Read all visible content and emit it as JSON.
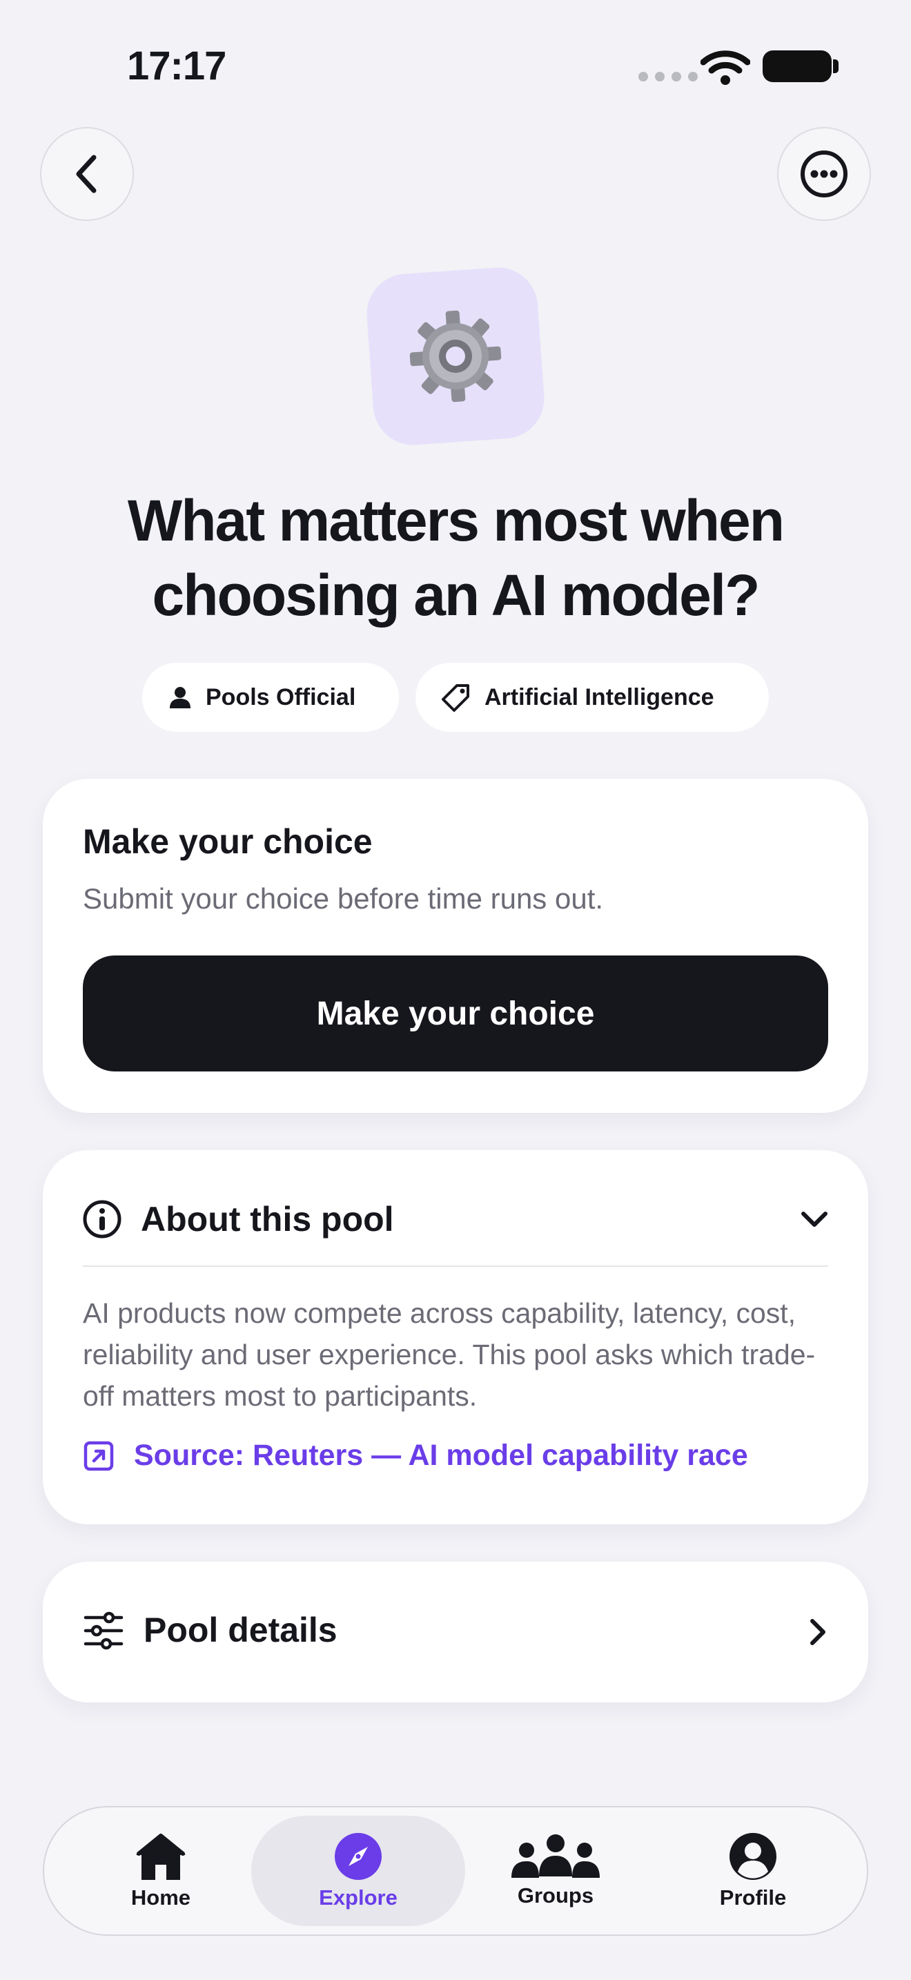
{
  "status_bar": {
    "time": "17:17"
  },
  "nav": {
    "back_icon": "chevron-left-icon",
    "more_icon": "ellipsis-circle-icon"
  },
  "pool": {
    "icon": "gear-icon",
    "title": "What matters most when choosing an AI model?",
    "owner": "Pools Official",
    "topic": "Artificial Intelligence"
  },
  "choice_card": {
    "heading": "Make your choice",
    "subtitle": "Submit your choice before time runs out.",
    "button_label": "Make your choice"
  },
  "about_card": {
    "heading": "About this pool",
    "expanded": true,
    "body": "AI products now compete across capability, latency, cost, reliability and user experience. This pool asks which trade-off matters most to participants.",
    "source_link": "Source: Reuters — AI model capability race"
  },
  "details_card": {
    "heading": "Pool details"
  },
  "tabbar": {
    "active": "Explore",
    "accent": "#6a3de8",
    "tabs": [
      {
        "label": "Home",
        "icon": "house-icon"
      },
      {
        "label": "Explore",
        "icon": "compass-icon"
      },
      {
        "label": "Groups",
        "icon": "people-icon"
      },
      {
        "label": "Profile",
        "icon": "person-circle-icon"
      }
    ]
  }
}
